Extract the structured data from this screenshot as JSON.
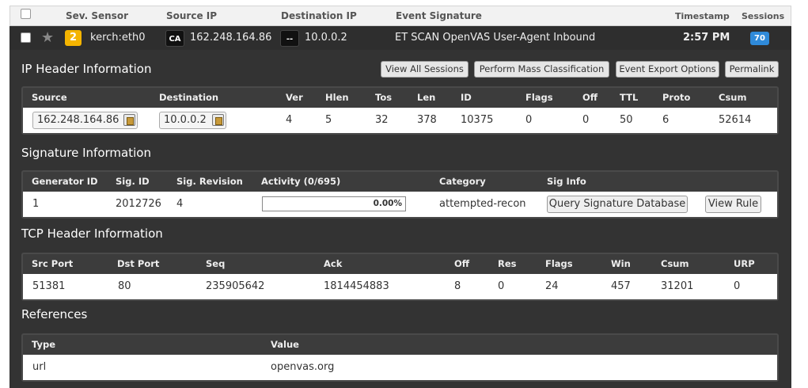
{
  "list_header": {
    "sev_sensor": "Sev. Sensor",
    "source_ip": "Source IP",
    "destination_ip": "Destination IP",
    "event_signature": "Event Signature",
    "timestamp": "Timestamp",
    "sessions": "Sessions"
  },
  "event": {
    "severity": "2",
    "sensor": "kerch:eth0",
    "source_country": "CA",
    "source_ip": "162.248.164.86",
    "dest_country": "--",
    "dest_ip": "10.0.0.2",
    "signature": "ET SCAN OpenVAS User-Agent Inbound",
    "timestamp": "2:57 PM",
    "sessions": "70",
    "severity_color": "#f4b400",
    "sessions_color": "#2f8ad9"
  },
  "buttons": {
    "view_all_sessions": "View All Sessions",
    "mass_classification": "Perform Mass Classification",
    "export_options": "Event Export Options",
    "permalink": "Permalink"
  },
  "ip_header": {
    "title": "IP Header Information",
    "columns": [
      "Source",
      "Destination",
      "Ver",
      "Hlen",
      "Tos",
      "Len",
      "ID",
      "Flags",
      "Off",
      "TTL",
      "Proto",
      "Csum"
    ],
    "values": {
      "source": "162.248.164.86",
      "destination": "10.0.0.2",
      "ver": "4",
      "hlen": "5",
      "tos": "32",
      "len": "378",
      "id": "10375",
      "flags": "0",
      "off": "0",
      "ttl": "50",
      "proto": "6",
      "csum": "52614"
    }
  },
  "signature": {
    "title": "Signature Information",
    "columns": [
      "Generator ID",
      "Sig. ID",
      "Sig. Revision",
      "Activity (0/695)",
      "Category",
      "Sig Info"
    ],
    "values": {
      "generator_id": "1",
      "sig_id": "2012726",
      "revision": "4",
      "activity": "0.00%",
      "category": "attempted-recon",
      "query_button": "Query Signature Database",
      "view_rule_button": "View Rule"
    }
  },
  "tcp_header": {
    "title": "TCP Header Information",
    "columns": [
      "Src Port",
      "Dst Port",
      "Seq",
      "Ack",
      "Off",
      "Res",
      "Flags",
      "Win",
      "Csum",
      "URP"
    ],
    "values": [
      "51381",
      "80",
      "235905642",
      "1814454883",
      "8",
      "0",
      "24",
      "457",
      "31201",
      "0"
    ]
  },
  "references": {
    "title": "References",
    "columns": [
      "Type",
      "Value"
    ],
    "values": [
      "url",
      "openvas.org"
    ]
  }
}
